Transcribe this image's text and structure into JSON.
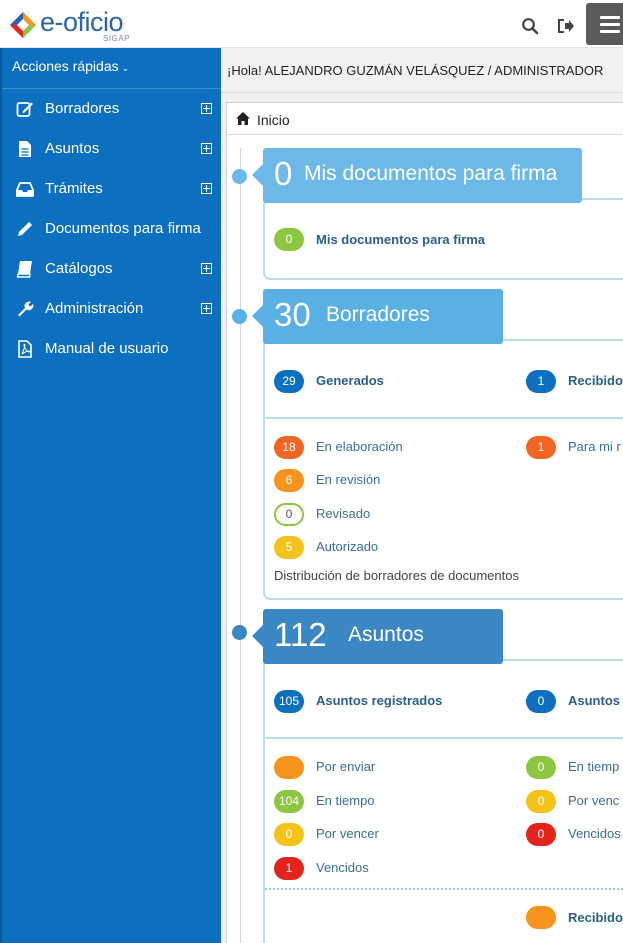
{
  "header": {
    "logo_text": "e-oficio",
    "logo_sub": "SIGAP",
    "icons": [
      "search-icon",
      "logout-icon",
      "menu-icon"
    ]
  },
  "sidebar": {
    "quick_actions": "Acciones rápidas",
    "items": [
      {
        "label": "Borradores",
        "icon": "edit-icon",
        "expandable": true
      },
      {
        "label": "Asuntos",
        "icon": "file-icon",
        "expandable": true
      },
      {
        "label": "Trámites",
        "icon": "inbox-icon",
        "expandable": true
      },
      {
        "label": "Documentos para firma",
        "icon": "pencil-icon",
        "expandable": false
      },
      {
        "label": "Catálogos",
        "icon": "book-icon",
        "expandable": true
      },
      {
        "label": "Administración",
        "icon": "wrench-icon",
        "expandable": true
      },
      {
        "label": "Manual de usuario",
        "icon": "pdf-icon",
        "expandable": false
      }
    ]
  },
  "greeting": "¡Hola! ALEJANDRO GUZMÁN VELÁSQUEZ / ADMINISTRADOR",
  "breadcrumb": "Inicio",
  "firma": {
    "count": "0",
    "title": "Mis documentos para firma",
    "item_count": "0",
    "item_label": "Mis documentos para firma"
  },
  "borradores": {
    "count": "30",
    "title": "Borradores",
    "generados_count": "29",
    "generados_label": "Generados",
    "recibidos_count": "1",
    "recibidos_label": "Recibido",
    "en_elaboracion_count": "18",
    "en_elaboracion_label": "En elaboración",
    "para_mi_count": "1",
    "para_mi_label": "Para mi r",
    "en_revision_count": "6",
    "en_revision_label": "En revisión",
    "revisado_count": "0",
    "revisado_label": "Revisado",
    "autorizado_count": "5",
    "autorizado_label": "Autorizado",
    "note": "Distribución de borradores de documentos"
  },
  "asuntos": {
    "count": "112",
    "title": "Asuntos",
    "registrados_count": "105",
    "registrados_label": "Asuntos registrados",
    "right_count": "0",
    "right_label": "Asuntos",
    "por_enviar_label": "Por enviar",
    "en_tiempo_count": "104",
    "en_tiempo_label": "En tiempo",
    "por_vencer_count": "0",
    "por_vencer_label": "Por vencer",
    "vencidos_count": "1",
    "vencidos_label": "Vencidos",
    "r_en_tiempo_count": "0",
    "r_en_tiempo_label": "En tiemp",
    "r_por_vencer_count": "0",
    "r_por_vencer_label": "Por venc",
    "r_vencidos_count": "0",
    "r_vencidos_label": "Vencidos",
    "recibidos_label": "Recibido"
  },
  "colors": {
    "sidebar": "#0c6fbf",
    "head_light": "#6cb8e8",
    "head_mid": "#5ab0e5",
    "head_dark": "#3a87c3",
    "green": "#8dc63f",
    "blue": "#0c6fbf",
    "orange_red": "#f26522",
    "orange": "#f7941d",
    "yellow": "#f4c319",
    "red": "#e2241c"
  }
}
